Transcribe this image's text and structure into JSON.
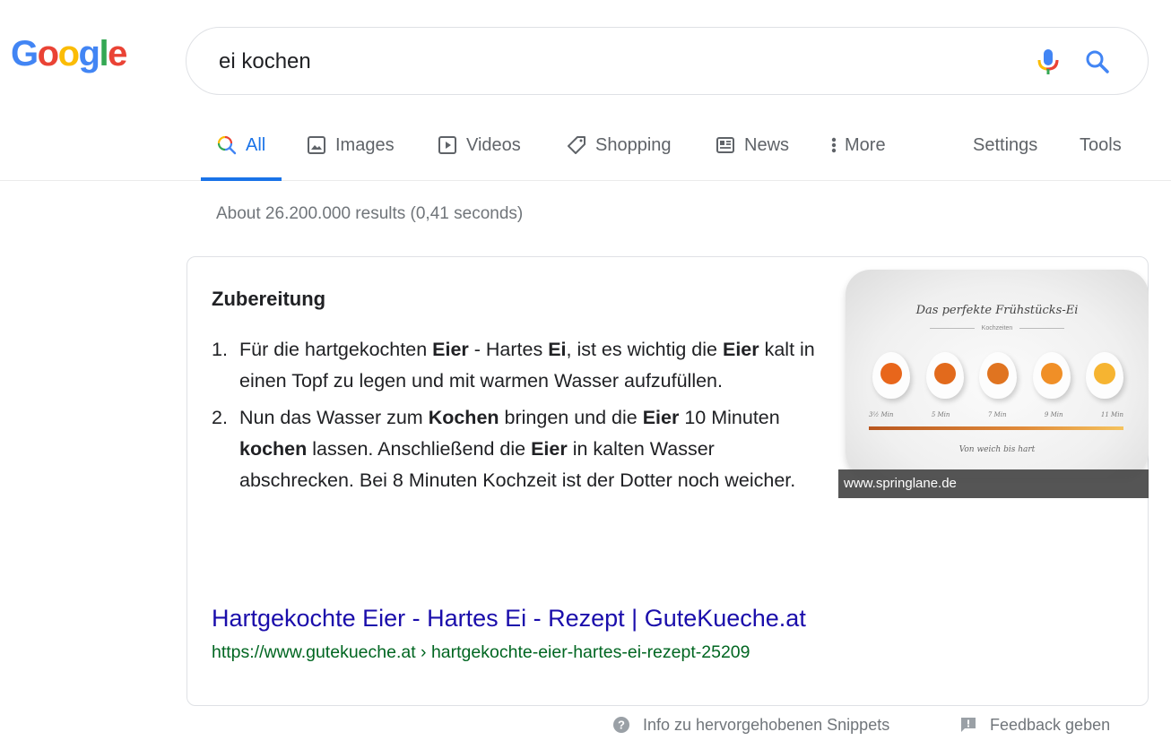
{
  "logo": {
    "letters": [
      "G",
      "o",
      "o",
      "g",
      "l",
      "e"
    ],
    "colors": [
      "#4285f4",
      "#ea4335",
      "#fbbc05",
      "#4285f4",
      "#34a853",
      "#ea4335"
    ]
  },
  "search": {
    "query": "ei kochen",
    "mic_icon": "microphone-icon",
    "search_icon": "magnifier-icon"
  },
  "tabs": [
    {
      "label": "All",
      "icon": "search-icon",
      "active": true
    },
    {
      "label": "Images",
      "icon": "image-icon",
      "active": false
    },
    {
      "label": "Videos",
      "icon": "play-icon",
      "active": false
    },
    {
      "label": "Shopping",
      "icon": "tag-icon",
      "active": false
    },
    {
      "label": "News",
      "icon": "news-icon",
      "active": false
    },
    {
      "label": "More",
      "icon": "kebab-icon",
      "active": false
    }
  ],
  "tools": {
    "settings": "Settings",
    "tools": "Tools"
  },
  "stats": "About 26.200.000 results (0,41 seconds)",
  "snippet": {
    "heading": "Zubereitung",
    "steps": [
      {
        "num": "1.",
        "parts": [
          {
            "t": "Für die hartgekochten ",
            "b": false
          },
          {
            "t": "Eier",
            "b": true
          },
          {
            "t": " - Hartes ",
            "b": false
          },
          {
            "t": "Ei",
            "b": true
          },
          {
            "t": ", ist es wichtig die ",
            "b": false
          },
          {
            "t": "Eier",
            "b": true
          },
          {
            "t": " kalt in einen Topf zu legen und mit warmen Wasser aufzufüllen.",
            "b": false
          }
        ]
      },
      {
        "num": "2.",
        "parts": [
          {
            "t": "Nun das Wasser zum ",
            "b": false
          },
          {
            "t": "Kochen",
            "b": true
          },
          {
            "t": " bringen und die ",
            "b": false
          },
          {
            "t": "Eier",
            "b": true
          },
          {
            "t": " 10 Minuten ",
            "b": false
          },
          {
            "t": "kochen",
            "b": true
          },
          {
            "t": " lassen. Anschließend die ",
            "b": false
          },
          {
            "t": "Eier",
            "b": true
          },
          {
            "t": " in kalten Wasser abschrecken. Bei 8 Minuten Kochzeit ist der Dotter noch weicher.",
            "b": false
          }
        ]
      }
    ],
    "image": {
      "title": "Das perfekte Frühstücks-Ei",
      "subtitle": "Kochzeiten",
      "times": [
        "3½ Min",
        "5 Min",
        "7 Min",
        "9 Min",
        "11 Min"
      ],
      "yolk_colors": [
        "#e8661b",
        "#e26a1c",
        "#e07420",
        "#f08f27",
        "#f6b431"
      ],
      "footer": "Von weich bis hart",
      "caption": "www.springlane.de"
    },
    "result_title": "Hartgekochte Eier - Hartes Ei - Rezept | GuteKueche.at",
    "result_url": "https://www.gutekueche.at › hartgekochte-eier-hartes-ei-rezept-25209"
  },
  "footer": {
    "info": "Info zu hervorgehobenen Snippets",
    "feedback": "Feedback geben"
  }
}
